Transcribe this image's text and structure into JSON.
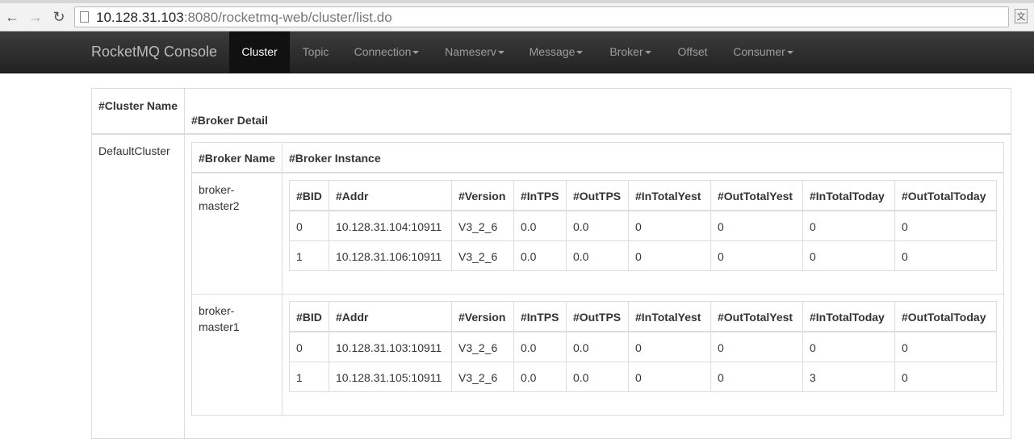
{
  "browser": {
    "url_host": "10.128.31.103",
    "url_rest": ":8080/rocketmq-web/cluster/list.do"
  },
  "navbar": {
    "brand": "RocketMQ Console",
    "items": [
      {
        "label": "Cluster",
        "dropdown": false,
        "active": true
      },
      {
        "label": "Topic",
        "dropdown": false
      },
      {
        "label": "Connection",
        "dropdown": true
      },
      {
        "label": "Nameserv",
        "dropdown": true
      },
      {
        "label": "Message",
        "dropdown": true
      },
      {
        "label": "Broker",
        "dropdown": true
      },
      {
        "label": "Offset",
        "dropdown": false
      },
      {
        "label": "Consumer",
        "dropdown": true
      }
    ]
  },
  "outer_table": {
    "headers": [
      "#Cluster Name",
      "#Broker Detail"
    ],
    "cluster_name": "DefaultCluster"
  },
  "broker_table": {
    "headers": [
      "#Broker Name",
      "#Broker Instance"
    ],
    "instance_headers": [
      "#BID",
      "#Addr",
      "#Version",
      "#InTPS",
      "#OutTPS",
      "#InTotalYest",
      "#OutTotalYest",
      "#InTotalToday",
      "#OutTotalToday"
    ],
    "brokers": [
      {
        "name_line1": "broker-",
        "name_line2": "master2",
        "rows": [
          [
            "0",
            "10.128.31.104:10911",
            "V3_2_6",
            "0.0",
            "0.0",
            "0",
            "0",
            "0",
            "0"
          ],
          [
            "1",
            "10.128.31.106:10911",
            "V3_2_6",
            "0.0",
            "0.0",
            "0",
            "0",
            "0",
            "0"
          ]
        ]
      },
      {
        "name_line1": "broker-",
        "name_line2": "master1",
        "rows": [
          [
            "0",
            "10.128.31.103:10911",
            "V3_2_6",
            "0.0",
            "0.0",
            "0",
            "0",
            "0",
            "0"
          ],
          [
            "1",
            "10.128.31.105:10911",
            "V3_2_6",
            "0.0",
            "0.0",
            "0",
            "0",
            "3",
            "0"
          ]
        ]
      }
    ]
  }
}
